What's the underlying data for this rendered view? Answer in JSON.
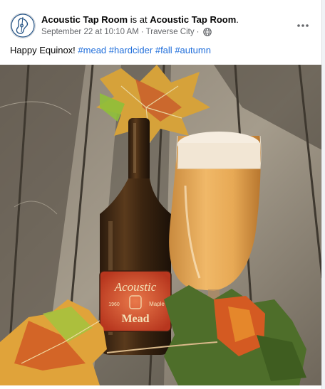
{
  "post": {
    "author": "Acoustic Tap Room",
    "connector": " is at ",
    "location_name": "Acoustic Tap Room",
    "location_suffix": ".",
    "timestamp": "September 22 at 10:10 AM",
    "separator": "·",
    "city": "Traverse City",
    "separator2": "·",
    "privacy_icon": "globe-icon",
    "more_icon": "ellipsis-icon",
    "caption_text": "Happy Equinox! ",
    "hashtags": [
      "#mead",
      "#hardcider",
      "#fall",
      "#autumn"
    ]
  },
  "photo": {
    "label_top": "Acoustic",
    "label_left": "1960",
    "label_right": "Maple",
    "label_bottom": "Mead"
  },
  "colors": {
    "link": "#216fdb",
    "text": "#050505",
    "meta": "#65676b"
  }
}
